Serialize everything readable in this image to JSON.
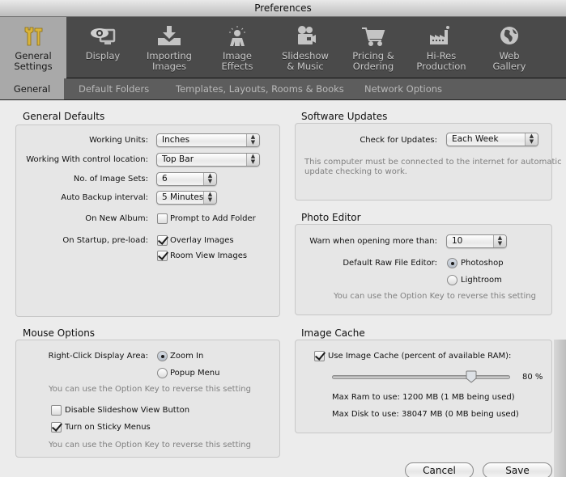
{
  "window": {
    "title": "Preferences"
  },
  "toolbar": {
    "items": [
      {
        "id": "general",
        "label_line1": "General",
        "label_line2": "Settings",
        "icon": "tools-icon",
        "active": true
      },
      {
        "id": "display",
        "label_line1": "Display",
        "label_line2": "",
        "icon": "eye-monitor-icon",
        "active": false
      },
      {
        "id": "importing",
        "label_line1": "Importing",
        "label_line2": "Images",
        "icon": "import-tray-icon",
        "active": false
      },
      {
        "id": "effects",
        "label_line1": "Image",
        "label_line2": "Effects",
        "icon": "person-spotlight-icon",
        "active": false
      },
      {
        "id": "slideshow",
        "label_line1": "Slideshow",
        "label_line2": "& Music",
        "icon": "movie-camera-icon",
        "active": false
      },
      {
        "id": "pricing",
        "label_line1": "Pricing &",
        "label_line2": "Ordering",
        "icon": "shopping-cart-icon",
        "active": false
      },
      {
        "id": "hires",
        "label_line1": "Hi-Res",
        "label_line2": "Production",
        "icon": "factory-icon",
        "active": false
      },
      {
        "id": "web",
        "label_line1": "Web",
        "label_line2": "Gallery",
        "icon": "globe-icon",
        "active": false
      }
    ]
  },
  "subtabs": [
    {
      "label": "General",
      "active": true
    },
    {
      "label": "Default Folders",
      "active": false
    },
    {
      "label": "Templates, Layouts, Rooms & Books",
      "active": false
    },
    {
      "label": "Network Options",
      "active": false
    }
  ],
  "general_defaults": {
    "title": "General Defaults",
    "working_units": {
      "label": "Working Units:",
      "value": "Inches"
    },
    "control_location": {
      "label": "Working With control location:",
      "value": "Top Bar"
    },
    "image_sets": {
      "label": "No. of Image Sets:",
      "value": "6"
    },
    "backup_interval": {
      "label": "Auto Backup interval:",
      "value": "5 Minutes"
    },
    "new_album": {
      "label": "On New Album:",
      "option": "Prompt to Add Folder",
      "checked": false
    },
    "startup_preload": {
      "label": "On Startup, pre-load:",
      "options": [
        {
          "label": "Overlay Images",
          "checked": true
        },
        {
          "label": "Room View Images",
          "checked": true
        }
      ]
    }
  },
  "mouse_options": {
    "title": "Mouse Options",
    "right_click": {
      "label": "Right-Click Display Area:",
      "options": [
        {
          "label": "Zoom In",
          "selected": true
        },
        {
          "label": "Popup Menu",
          "selected": false
        }
      ]
    },
    "hint1": "You can use the Option Key to reverse this setting",
    "disable_slideshow": {
      "label": "Disable Slideshow View Button",
      "checked": false
    },
    "sticky_menus": {
      "label": "Turn on Sticky Menus",
      "checked": true
    },
    "hint2": "You can use the Option Key to reverse this setting"
  },
  "software_updates": {
    "title": "Software Updates",
    "check": {
      "label": "Check for Updates:",
      "value": "Each Week"
    },
    "note_line1": "This computer must be connected to the internet for automatic",
    "note_line2": "update checking to work."
  },
  "photo_editor": {
    "title": "Photo Editor",
    "warn": {
      "label": "Warn when opening more than:",
      "value": "10"
    },
    "raw_editor": {
      "label": "Default Raw File Editor:",
      "options": [
        {
          "label": "Photoshop",
          "selected": true
        },
        {
          "label": "Lightroom",
          "selected": false
        }
      ]
    },
    "hint": "You can use the Option Key to reverse this setting"
  },
  "image_cache": {
    "title": "Image Cache",
    "use_cache": {
      "label": "Use Image Cache (percent of available RAM):",
      "checked": true
    },
    "slider_percent": 80,
    "slider_label": "80 %",
    "max_ram": "Max Ram to use: 1200 MB  (1 MB being used)",
    "max_disk": "Max Disk to use: 38047 MB  (0 MB being used)"
  },
  "buttons": {
    "cancel": "Cancel",
    "save": "Save"
  }
}
